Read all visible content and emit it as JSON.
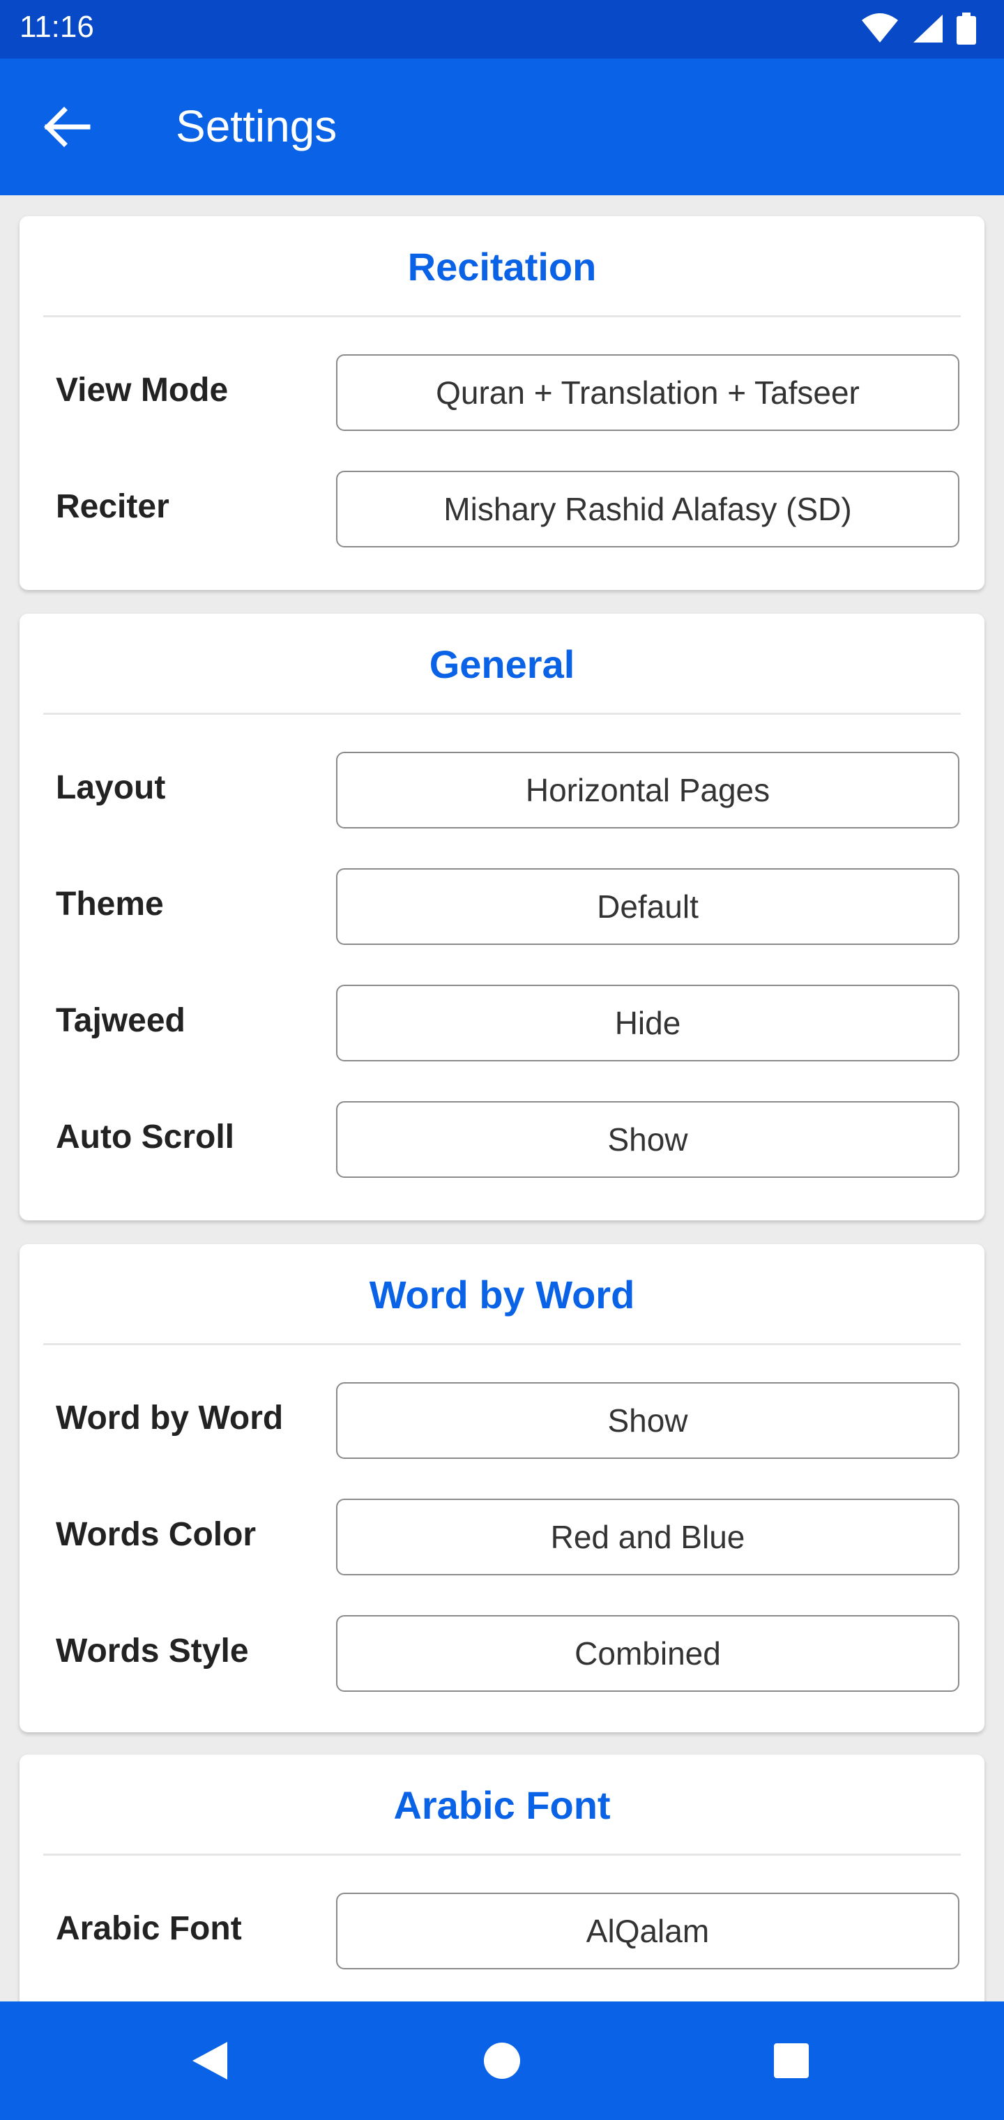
{
  "status_bar": {
    "time": "11:16"
  },
  "app_bar": {
    "title": "Settings"
  },
  "sections": [
    {
      "title": "Recitation",
      "rows": [
        {
          "label": "View Mode",
          "value": "Quran + Translation + Tafseer"
        },
        {
          "label": "Reciter",
          "value": "Mishary Rashid Alafasy (SD)"
        }
      ]
    },
    {
      "title": "General",
      "rows": [
        {
          "label": "Layout",
          "value": "Horizontal Pages"
        },
        {
          "label": "Theme",
          "value": "Default"
        },
        {
          "label": "Tajweed",
          "value": "Hide"
        },
        {
          "label": "Auto Scroll",
          "value": "Show"
        }
      ]
    },
    {
      "title": "Word by Word",
      "rows": [
        {
          "label": "Word by Word",
          "value": "Show"
        },
        {
          "label": "Words Color",
          "value": "Red and Blue"
        },
        {
          "label": "Words Style",
          "value": "Combined"
        }
      ]
    },
    {
      "title": "Arabic Font",
      "rows": [
        {
          "label": "Arabic Font",
          "value": "AlQalam"
        }
      ]
    }
  ],
  "colors": {
    "primary": "#0a62e6",
    "status_bar": "#0849c7",
    "background": "#ececec"
  }
}
